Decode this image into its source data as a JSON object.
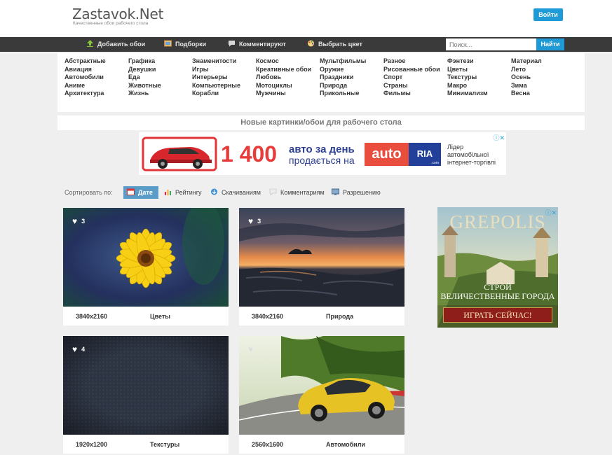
{
  "header": {
    "logo": "Zastavok.Net",
    "tagline": "Качественные обои рабочего стола",
    "login_label": "Войти"
  },
  "nav": {
    "items": [
      {
        "label": "Добавить обои",
        "icon": "upload-icon"
      },
      {
        "label": "Подборки",
        "icon": "collection-icon"
      },
      {
        "label": "Комментируют",
        "icon": "comment-icon"
      },
      {
        "label": "Выбрать цвет",
        "icon": "palette-icon"
      }
    ],
    "search_placeholder": "Поиск...",
    "search_button": "Найти"
  },
  "categories": [
    [
      "Абстрактные",
      "Авиация",
      "Автомобили",
      "Аниме",
      "Архитектура"
    ],
    [
      "Графика",
      "Девушки",
      "Еда",
      "Животные",
      "Жизнь"
    ],
    [
      "Знаменитости",
      "Игры",
      "Интерьеры",
      "Компьютерные",
      "Корабли"
    ],
    [
      "Космос",
      "Креативные обои",
      "Любовь",
      "Мотоциклы",
      "Мужчины"
    ],
    [
      "Мультфильмы",
      "Оружие",
      "Праздники",
      "Природа",
      "Прикольные"
    ],
    [
      "Разное",
      "Рисованные обои",
      "Спорт",
      "Страны",
      "Фильмы"
    ],
    [
      "Фэнтези",
      "Цветы",
      "Текстуры",
      "Макро",
      "Минимализм"
    ],
    [
      "Материал",
      "Лето",
      "Осень",
      "Зима",
      "Весна"
    ]
  ],
  "section_title": "Новые картинки/обои для рабочего стола",
  "ad_top": {
    "number": "1 400",
    "line1": "авто за день",
    "line2": "продається на",
    "logo_left": "auto",
    "logo_right": "RIA",
    "logo_domain": ".com",
    "desc1": "Лідер",
    "desc2": "автомобільної",
    "desc3": "інтернет-торгівлі"
  },
  "sort": {
    "label": "Сортировать по:",
    "items": [
      {
        "label": "Дате",
        "active": true,
        "icon": "calendar-icon"
      },
      {
        "label": "Рейтингу",
        "active": false,
        "icon": "bar-chart-icon"
      },
      {
        "label": "Скачиваниям",
        "active": false,
        "icon": "download-icon"
      },
      {
        "label": "Комментариям",
        "active": false,
        "icon": "comment-icon"
      },
      {
        "label": "Разрешению",
        "active": false,
        "icon": "resolution-icon"
      }
    ]
  },
  "cards": [
    {
      "likes": "3",
      "resolution": "3840x2160",
      "category": "Цветы"
    },
    {
      "likes": "3",
      "resolution": "3840x2160",
      "category": "Природа"
    },
    {
      "likes": "4",
      "resolution": "1920x1200",
      "category": "Текстуры"
    },
    {
      "likes": "",
      "resolution": "2560x1600",
      "category": "Автомобили"
    }
  ],
  "ad_right": {
    "title": "GREPOLIS",
    "sub1": "СТРОЙ",
    "sub2": "ВЕЛИЧЕСТВЕННЫЕ ГОРОДА",
    "cta": "ИГРАТЬ СЕЙЧАС!"
  },
  "colors": {
    "accent": "#1e9ad6",
    "nav_bg": "#3a3a3a",
    "sort_active": "#5b9bc7"
  }
}
